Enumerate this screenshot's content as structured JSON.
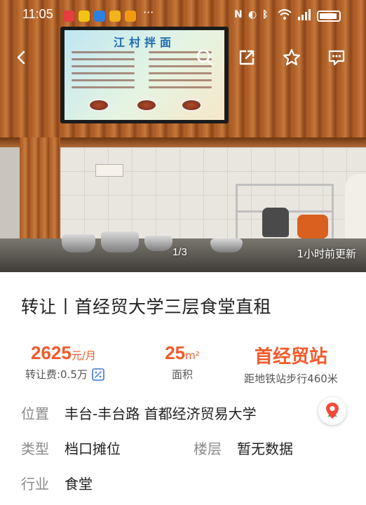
{
  "status_bar": {
    "time": "11:05",
    "app_icon_colors": [
      "#e63e3e",
      "#f3c312",
      "#2d7fe0",
      "#f2b31b",
      "#f29a14"
    ],
    "more_label": "···"
  },
  "nav": {
    "back_icon": "chevron-left-icon",
    "search_icon": "search-icon",
    "share_icon": "share-icon",
    "favorite_icon": "star-icon",
    "message_icon": "message-icon"
  },
  "gallery": {
    "page_indicator": "1/3",
    "updated": "1小时前更新",
    "menu_board_title": "江村拌面"
  },
  "listing": {
    "title": "转让丨首经贸大学三层食堂直租",
    "rent_value": "2625",
    "rent_unit": "元/月",
    "transfer_fee": "转让费:0.5万",
    "area_value": "25",
    "area_unit": "m²",
    "area_label": "面积",
    "station_name": "首经贸站",
    "station_distance": "距地铁站步行460米"
  },
  "details": {
    "location_label": "位置",
    "location_value": "丰台-丰台路 首都经济贸易大学",
    "type_label": "类型",
    "type_value": "档口摊位",
    "floor_label": "楼层",
    "floor_value": "暂无数据",
    "industry_label": "行业",
    "industry_value": "食堂"
  },
  "colors": {
    "accent": "#f25a2a",
    "label_gray": "#8a8a8a",
    "calc_blue": "#3a72d8"
  }
}
